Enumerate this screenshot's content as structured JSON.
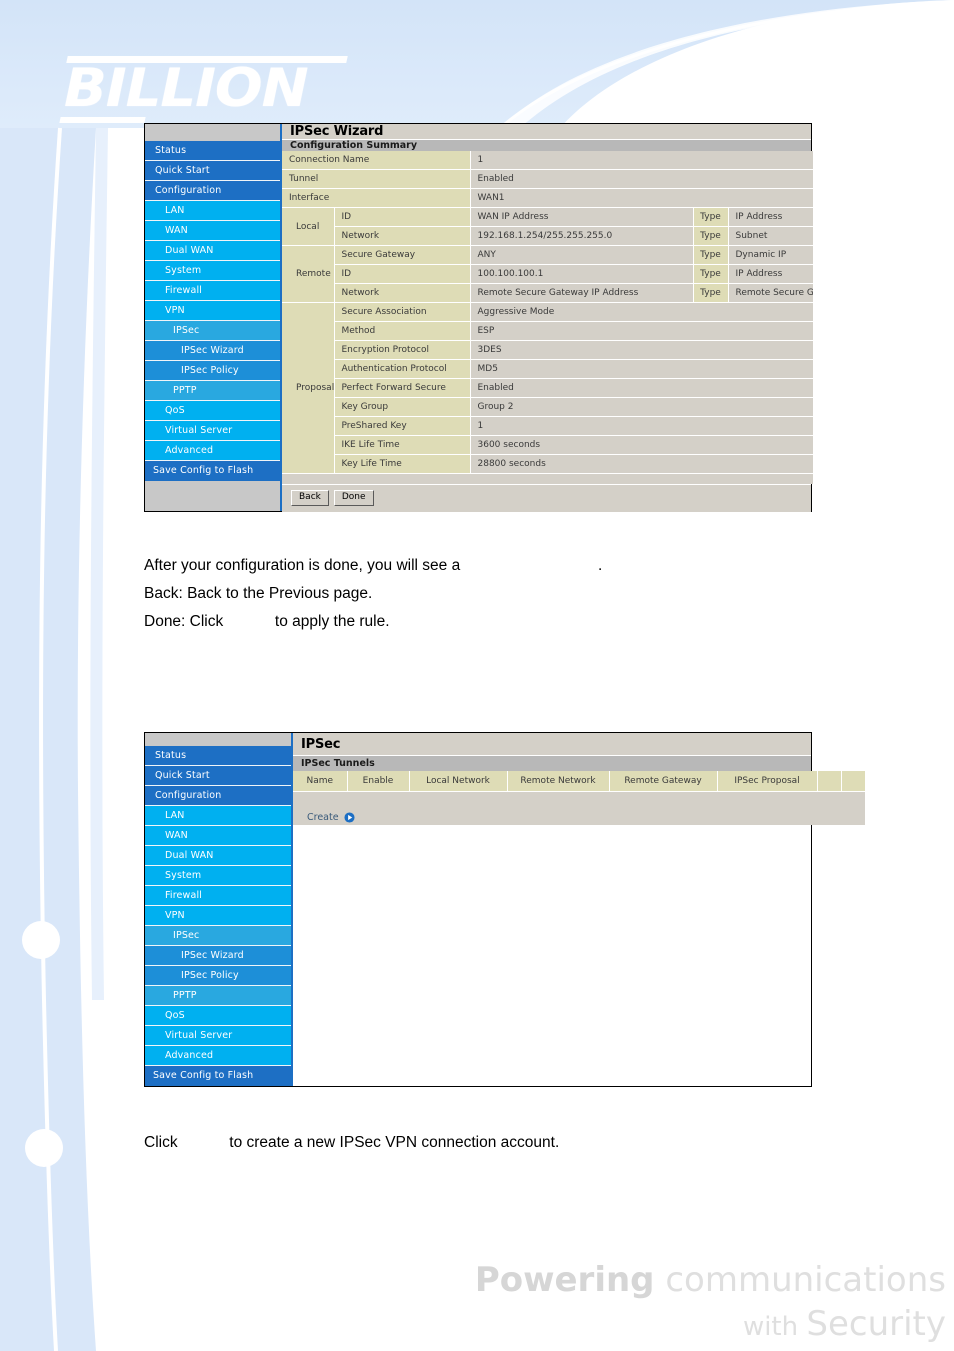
{
  "brand": {
    "logo_text": "BILLION"
  },
  "sidebar": {
    "items": [
      {
        "label": "Status",
        "level": 0
      },
      {
        "label": "Quick Start",
        "level": 0
      },
      {
        "label": "Configuration",
        "level": 0
      },
      {
        "label": "LAN",
        "level": 1
      },
      {
        "label": "WAN",
        "level": 1
      },
      {
        "label": "Dual WAN",
        "level": 1
      },
      {
        "label": "System",
        "level": 1
      },
      {
        "label": "Firewall",
        "level": 1
      },
      {
        "label": "VPN",
        "level": 1
      },
      {
        "label": "IPSec",
        "level": 2
      },
      {
        "label": "IPSec Wizard",
        "level": 3
      },
      {
        "label": "IPSec Policy",
        "level": 3
      },
      {
        "label": "PPTP",
        "level": 2
      },
      {
        "label": "QoS",
        "level": 1
      },
      {
        "label": "Virtual Server",
        "level": 1
      },
      {
        "label": "Advanced",
        "level": 1
      },
      {
        "label": "Save Config to Flash",
        "level": 4
      }
    ]
  },
  "wizard_panel": {
    "page_title": "IPSec Wizard",
    "section_title": "Configuration Summary",
    "rows": [
      {
        "group": "",
        "key": "Connection Name",
        "value": "1",
        "type_label": "",
        "type_value": ""
      },
      {
        "group": "",
        "key": "Tunnel",
        "value": "Enabled",
        "type_label": "",
        "type_value": ""
      },
      {
        "group": "",
        "key": "Interface",
        "value": "WAN1",
        "type_label": "",
        "type_value": ""
      },
      {
        "group": "Local",
        "key": "ID",
        "value": "WAN IP Address",
        "type_label": "Type",
        "type_value": "IP Address"
      },
      {
        "group": "Local",
        "key": "Network",
        "value": "192.168.1.254/255.255.255.0",
        "type_label": "Type",
        "type_value": "Subnet"
      },
      {
        "group": "Remote",
        "key": "Secure Gateway",
        "value": "ANY",
        "type_label": "Type",
        "type_value": "Dynamic IP"
      },
      {
        "group": "Remote",
        "key": "ID",
        "value": "100.100.100.1",
        "type_label": "Type",
        "type_value": "IP Address"
      },
      {
        "group": "Remote",
        "key": "Network",
        "value": "Remote Secure Gateway IP Address",
        "type_label": "Type",
        "type_value": "Remote Secure Gateway"
      },
      {
        "group": "Proposal",
        "key": "Secure Association",
        "value": "Aggressive Mode",
        "type_label": "",
        "type_value": ""
      },
      {
        "group": "Proposal",
        "key": "Method",
        "value": "ESP",
        "type_label": "",
        "type_value": ""
      },
      {
        "group": "Proposal",
        "key": "Encryption Protocol",
        "value": "3DES",
        "type_label": "",
        "type_value": ""
      },
      {
        "group": "Proposal",
        "key": "Authentication Protocol",
        "value": "MD5",
        "type_label": "",
        "type_value": ""
      },
      {
        "group": "Proposal",
        "key": "Perfect Forward Secure",
        "value": "Enabled",
        "type_label": "",
        "type_value": ""
      },
      {
        "group": "Proposal",
        "key": "Key Group",
        "value": "Group 2",
        "type_label": "",
        "type_value": ""
      },
      {
        "group": "Proposal",
        "key": "PreShared Key",
        "value": "1",
        "type_label": "",
        "type_value": ""
      },
      {
        "group": "Proposal",
        "key": "IKE Life Time",
        "value": "3600 seconds",
        "type_label": "",
        "type_value": ""
      },
      {
        "group": "Proposal",
        "key": "Key Life Time",
        "value": "28800 seconds",
        "type_label": "",
        "type_value": ""
      }
    ],
    "buttons": {
      "back": "Back",
      "done": "Done"
    }
  },
  "ipsec_panel": {
    "page_title": "IPSec",
    "section_title": "IPSec Tunnels",
    "columns": [
      "Name",
      "Enable",
      "Local Network",
      "Remote Network",
      "Remote Gateway",
      "IPSec Proposal",
      "",
      ""
    ],
    "rows": [],
    "create_label": "Create"
  },
  "prose": {
    "after_config": "After your configuration is done, you will see a                                .",
    "back_line": "Back: Back to the Previous page.",
    "done_line": "Done: Click            to apply the rule.",
    "click_create": "Click            to create a new IPSec VPN connection account."
  },
  "footer": {
    "tagline_bold": "Powering",
    "tagline_thin": " communications",
    "tagline_with": "with ",
    "tagline_security": "Security"
  },
  "colors": {
    "nav_top": "#1d6fc4",
    "nav_sub": "#00b0f0",
    "nav_sub2": "#29a8e0",
    "nav_sub3": "#1d8fd8",
    "table_key": "#dedcb6",
    "table_value": "#d4d0c8",
    "page_accent": "#d6e6f7"
  }
}
